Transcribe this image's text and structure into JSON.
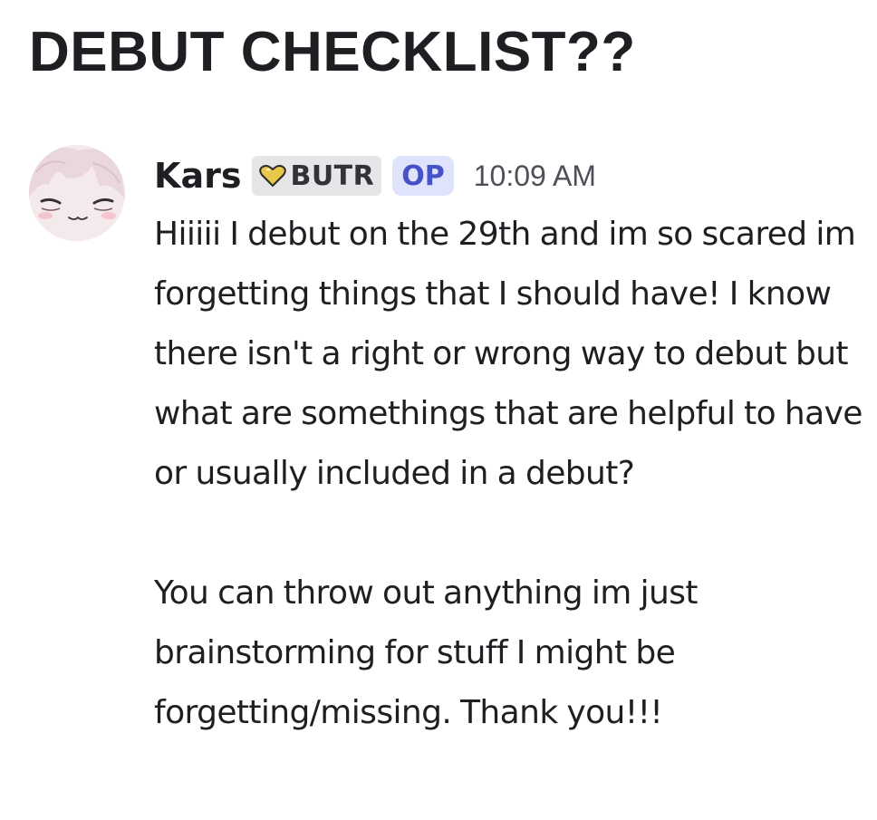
{
  "thread": {
    "title": "DEBUT CHECKLIST??"
  },
  "message": {
    "author": "Kars",
    "role_tag": {
      "label": "BUTR",
      "icon": "gold-heart-icon",
      "color": "#e8c84a"
    },
    "op_badge": "OP",
    "timestamp": "10:09 AM",
    "paragraphs": [
      "Hiiiii I debut on the 29th and im so scared im forgetting things that I should have! I know there isn't a right or wrong way to debut but what are somethings that are helpful to have or usually included in a debut?",
      "You can throw out anything im just brainstorming for stuff I might be forgetting/missing. Thank you!!!"
    ]
  },
  "colors": {
    "op_badge_bg": "#dfe3fb",
    "op_badge_text": "#4653c7",
    "role_tag_bg": "#e6e6e8"
  }
}
